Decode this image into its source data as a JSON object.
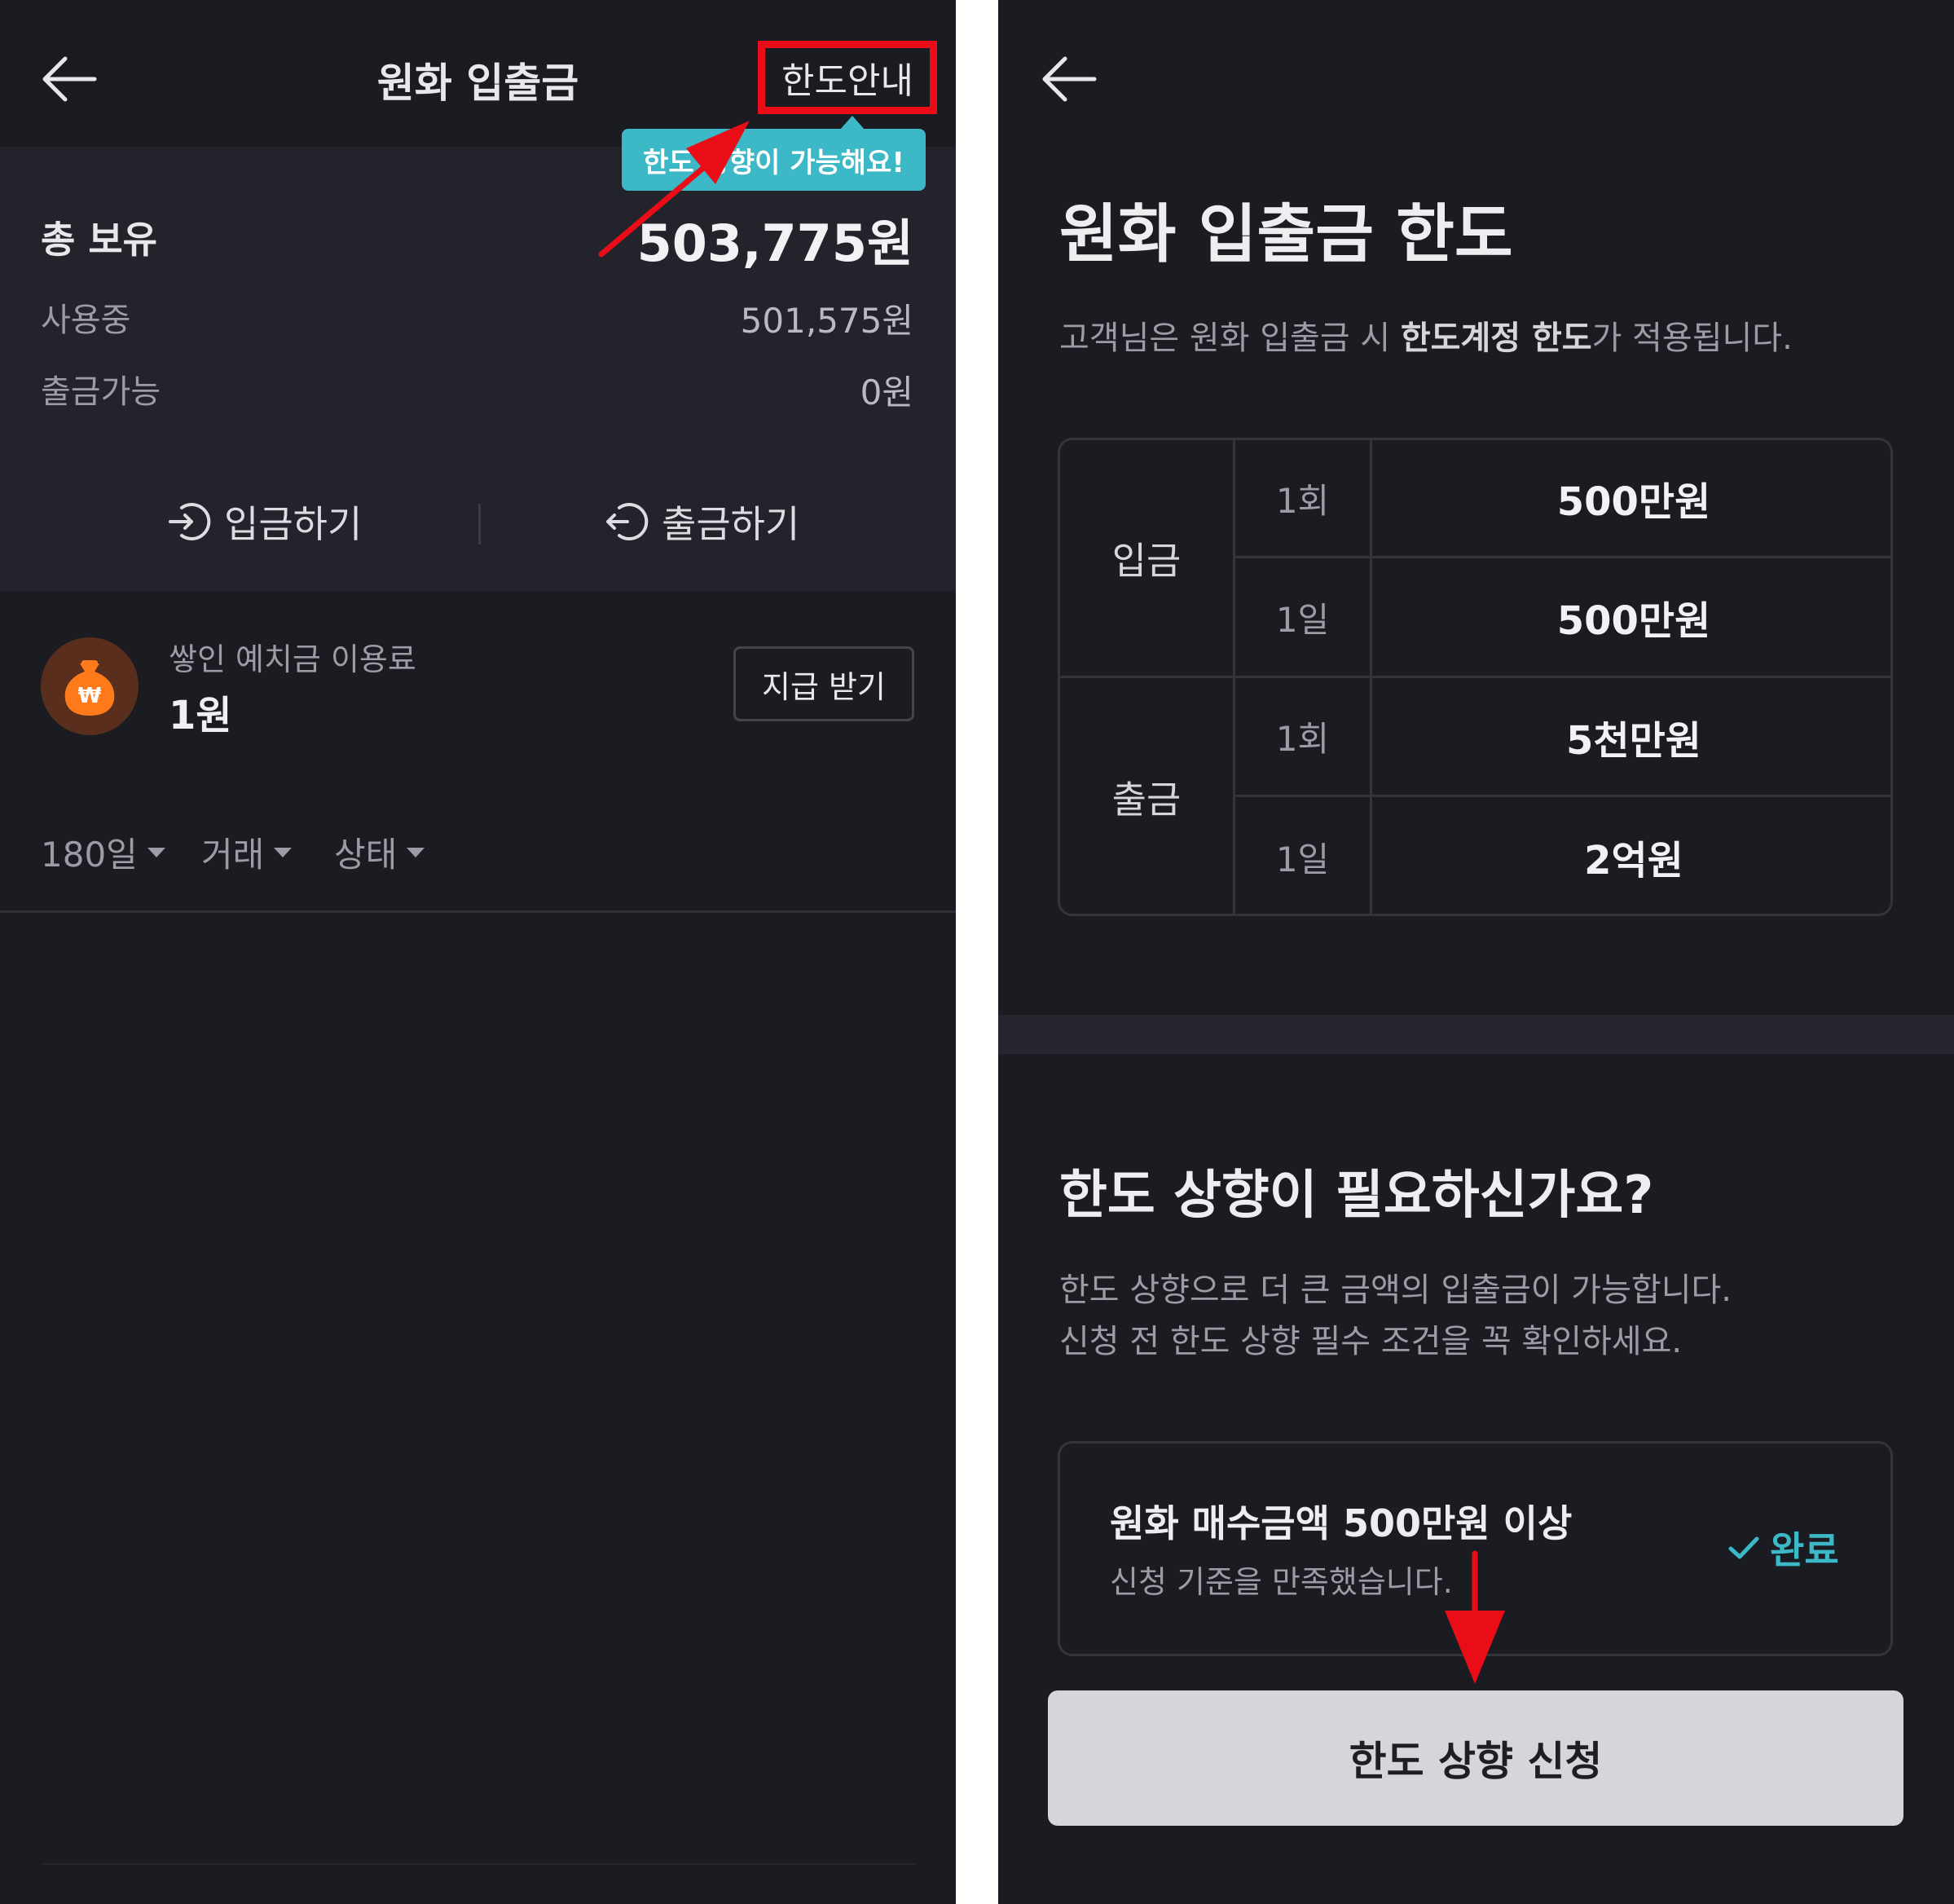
{
  "left_screen": {
    "header": {
      "title": "원화 입출금",
      "limit_guide_label": "한도안내"
    },
    "tooltip": "한도 상향이 가능해요!",
    "summary": {
      "total_label": "총 보유",
      "total_value": "503,775원",
      "rows": [
        {
          "label": "사용중",
          "value": "501,575원"
        },
        {
          "label": "출금가능",
          "value": "0원"
        }
      ]
    },
    "actions": {
      "deposit_label": "입금하기",
      "withdraw_label": "출금하기"
    },
    "reward": {
      "label": "쌓인 예치금 이용료",
      "value": "1원",
      "button_label": "지급 받기",
      "coin_symbol": "₩"
    },
    "filters": [
      "180일",
      "거래",
      "상태"
    ]
  },
  "right_screen": {
    "title": "원화 입출금 한도",
    "description": {
      "prefix": "고객님은 원화 입출금 시 ",
      "emphasis": "한도계정 한도",
      "suffix": "가 적용됩니다."
    },
    "limits": [
      {
        "group": "입금",
        "rows": [
          {
            "period": "1회",
            "amount": "500만원"
          },
          {
            "period": "1일",
            "amount": "500만원"
          }
        ]
      },
      {
        "group": "출금",
        "rows": [
          {
            "period": "1회",
            "amount": "5천만원"
          },
          {
            "period": "1일",
            "amount": "2억원"
          }
        ]
      }
    ],
    "upgrade": {
      "title": "한도 상향이 필요하신가요?",
      "lines": [
        "한도 상향으로 더 큰 금액의 입출금이 가능합니다.",
        "신청 전 한도 상향 필수 조건을 꼭 확인하세요."
      ]
    },
    "condition": {
      "title": "원화 매수금액 500만원 이상",
      "subtitle": "신청 기준을 만족했습니다.",
      "status": "완료"
    },
    "apply_button_label": "한도 상향 신청"
  },
  "colors": {
    "background": "#1b1c22",
    "card": "#23242b",
    "accent_teal": "#3cb8c6",
    "annotation_red": "#ea0c16",
    "button_gray": "#d5d5da"
  },
  "icons": [
    "back-arrow-icon",
    "deposit-icon",
    "withdraw-icon",
    "money-bag-icon",
    "checkmark-icon",
    "caret-down-icon"
  ]
}
